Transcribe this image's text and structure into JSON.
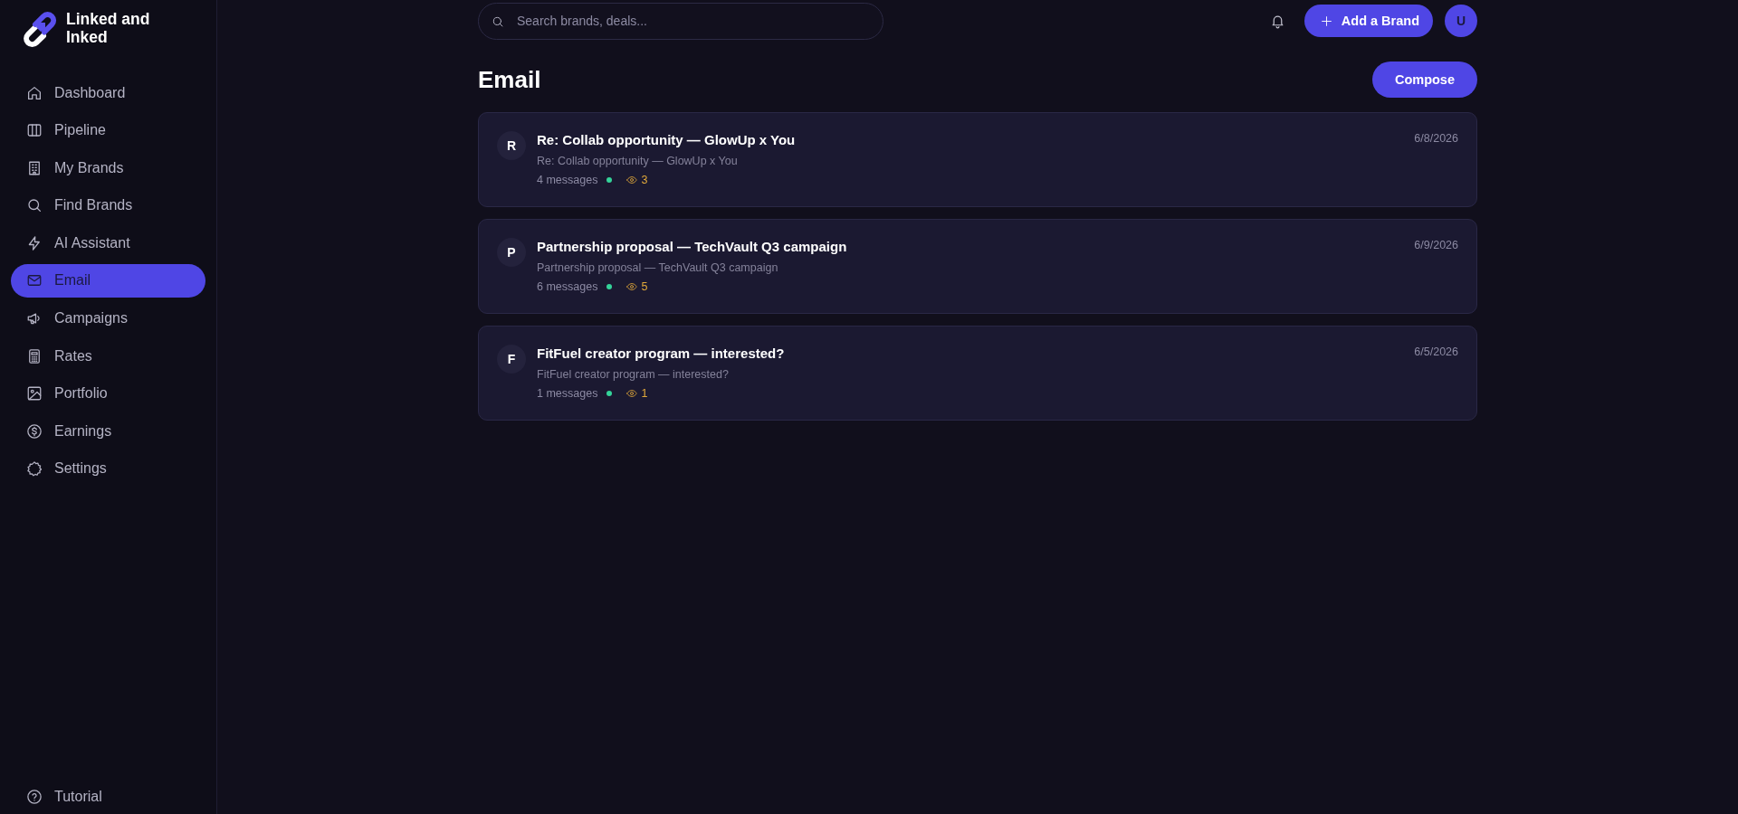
{
  "sidebar": {
    "brand": "Linked and Inked",
    "items": [
      {
        "label": "Dashboard",
        "selected": false
      },
      {
        "label": "Pipeline",
        "selected": false
      },
      {
        "label": "My Brands",
        "selected": false
      },
      {
        "label": "Find Brands",
        "selected": false
      },
      {
        "label": "AI Assistant",
        "selected": false
      },
      {
        "label": "Email",
        "selected": true
      },
      {
        "label": "Campaigns",
        "selected": false
      },
      {
        "label": "Rates",
        "selected": false
      },
      {
        "label": "Portfolio",
        "selected": false
      },
      {
        "label": "Earnings",
        "selected": false
      },
      {
        "label": "Settings",
        "selected": false
      }
    ],
    "footer_items": [
      {
        "label": "Tutorial"
      }
    ]
  },
  "topbar": {
    "search": {
      "placeholder": "Search brands, deals..."
    },
    "add_button": {
      "label": "Add a Brand"
    },
    "avatar": {
      "initial": "U"
    }
  },
  "page": {
    "title": "Email",
    "compose_button": {
      "label": "Compose"
    }
  },
  "threads": [
    {
      "initial": "R",
      "subject": "Re: Collab opportunity — GlowUp x You",
      "preview": "Re: Collab opportunity — GlowUp x You",
      "message_count": "4 messages",
      "views": "3",
      "date": "6/8/2026"
    },
    {
      "initial": "P",
      "subject": "Partnership proposal — TechVault Q3 campaign",
      "preview": "Partnership proposal — TechVault Q3 campaign",
      "message_count": "6 messages",
      "views": "5",
      "date": "6/9/2026"
    },
    {
      "initial": "F",
      "subject": "FitFuel creator program — interested?",
      "preview": "FitFuel creator program — interested?",
      "message_count": "1 messages",
      "views": "1",
      "date": "6/5/2026"
    }
  ]
}
